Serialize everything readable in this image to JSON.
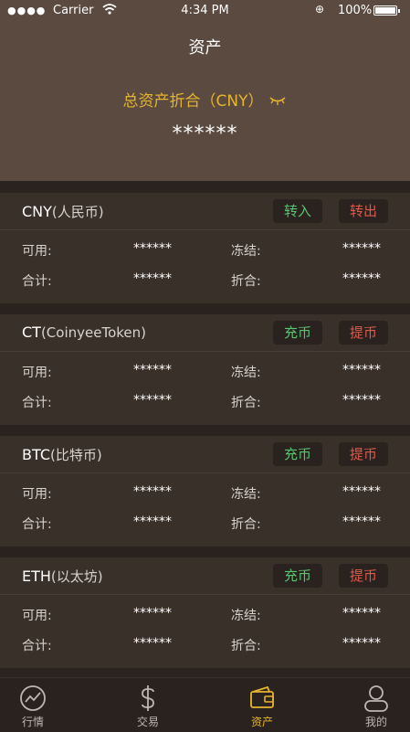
{
  "status": {
    "carrier": "Carrier",
    "time": "4:34 PM",
    "battery": "100%"
  },
  "header": {
    "title": "资产",
    "total_label": "总资产折合（CNY）",
    "total_value": "******",
    "accent": "#e6b52e"
  },
  "assets": [
    {
      "name": "CNY",
      "sub": "(人民币)",
      "in_label": "转入",
      "out_label": "转出",
      "available_label": "可用:",
      "available": "******",
      "frozen_label": "冻结:",
      "frozen": "******",
      "total_label": "合计:",
      "total": "******",
      "converted_label": "折合:",
      "converted": "******"
    },
    {
      "name": "CT",
      "sub": "(CoinyeeToken)",
      "in_label": "充币",
      "out_label": "提币",
      "available_label": "可用:",
      "available": "******",
      "frozen_label": "冻结:",
      "frozen": "******",
      "total_label": "合计:",
      "total": "******",
      "converted_label": "折合:",
      "converted": "******"
    },
    {
      "name": "BTC",
      "sub": "(比特币)",
      "in_label": "充币",
      "out_label": "提币",
      "available_label": "可用:",
      "available": "******",
      "frozen_label": "冻结:",
      "frozen": "******",
      "total_label": "合计:",
      "total": "******",
      "converted_label": "折合:",
      "converted": "******"
    },
    {
      "name": "ETH",
      "sub": "(以太坊)",
      "in_label": "充币",
      "out_label": "提币",
      "available_label": "可用:",
      "available": "******",
      "frozen_label": "冻结:",
      "frozen": "******",
      "total_label": "合计:",
      "total": "******",
      "converted_label": "折合:",
      "converted": "******"
    }
  ],
  "tabs": [
    {
      "label": "行情",
      "icon": "chart-line-icon"
    },
    {
      "label": "交易",
      "icon": "dollar-icon"
    },
    {
      "label": "资产",
      "icon": "wallet-icon",
      "active": true
    },
    {
      "label": "我的",
      "icon": "user-icon"
    }
  ]
}
